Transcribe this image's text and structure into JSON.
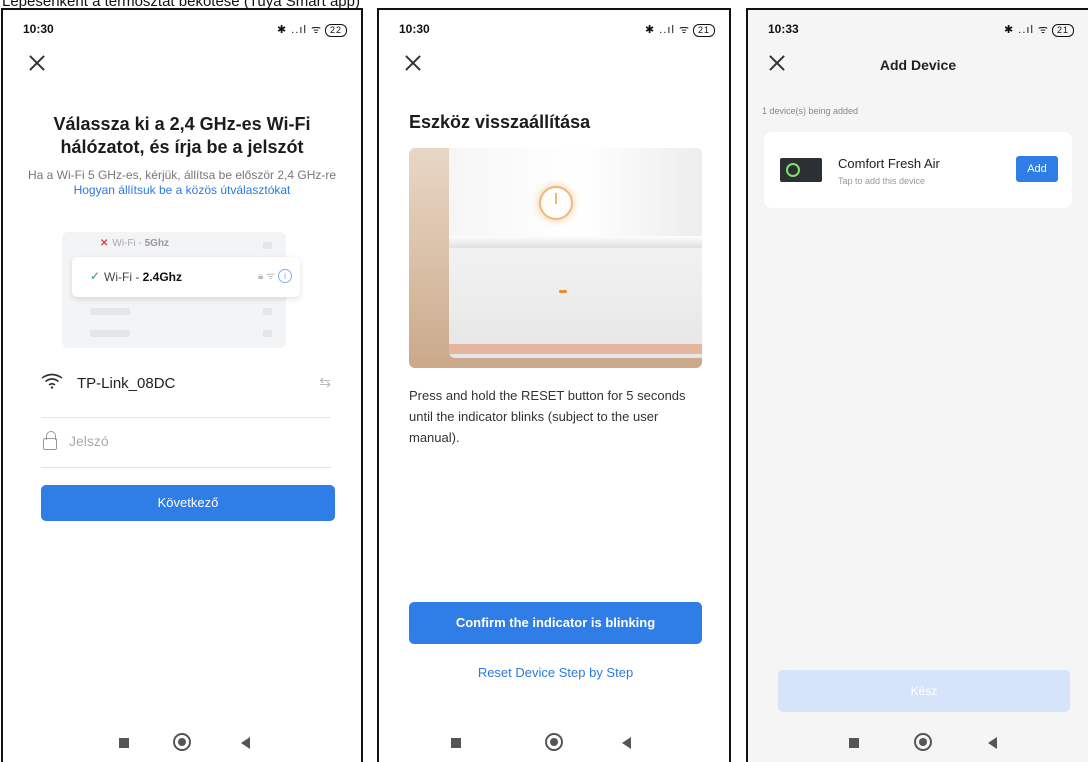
{
  "caption": "Lépésenként a termosztát bekötése (Tuya Smart app)",
  "panels": {
    "wifi": {
      "status_time": "10:30",
      "status_battery": "22",
      "title": "Válassza ki a 2,4 GHz-es Wi-Fi hálózatot, és írja be a jelszót",
      "subtitle": "Ha a Wi-Fi 5 GHz-es, kérjük, állítsa be először 2,4 GHz-re",
      "subtitle_link": "Hogyan állítsuk be a közös útválasztókat",
      "illustration": {
        "row1_prefix": "Wi-Fi - ",
        "row1_band": "5Ghz",
        "row2_prefix": "Wi-Fi - ",
        "row2_band": "2.4Ghz"
      },
      "ssid": "TP-Link_08DC",
      "password_placeholder": "Jelszó",
      "password_value": "",
      "next_label": "Következő"
    },
    "reset": {
      "status_time": "10:30",
      "status_battery": "21",
      "title": "Eszköz visszaállítása",
      "description": "Press and hold the RESET button for 5 seconds until the indicator blinks (subject to the user manual).",
      "confirm_label": "Confirm the indicator is blinking",
      "step_link": "Reset Device Step by Step"
    },
    "add": {
      "status_time": "10:33",
      "status_battery": "21",
      "title": "Add Device",
      "count_text": "1 device(s) being added",
      "device_name": "Comfort  Fresh Air",
      "device_hint": "Tap to add this device",
      "add_label": "Add",
      "done_label": "Kész"
    }
  },
  "icons": {
    "close": "close-icon",
    "wifi": "wifi-icon",
    "swap": "swap-icon",
    "lock": "lock-icon",
    "power": "power-icon"
  },
  "colors": {
    "accent": "#2f7de6",
    "link": "#2a7ae4",
    "success": "#2f9b66",
    "error": "#e04747",
    "disabled_button": "#d5e4f8"
  }
}
